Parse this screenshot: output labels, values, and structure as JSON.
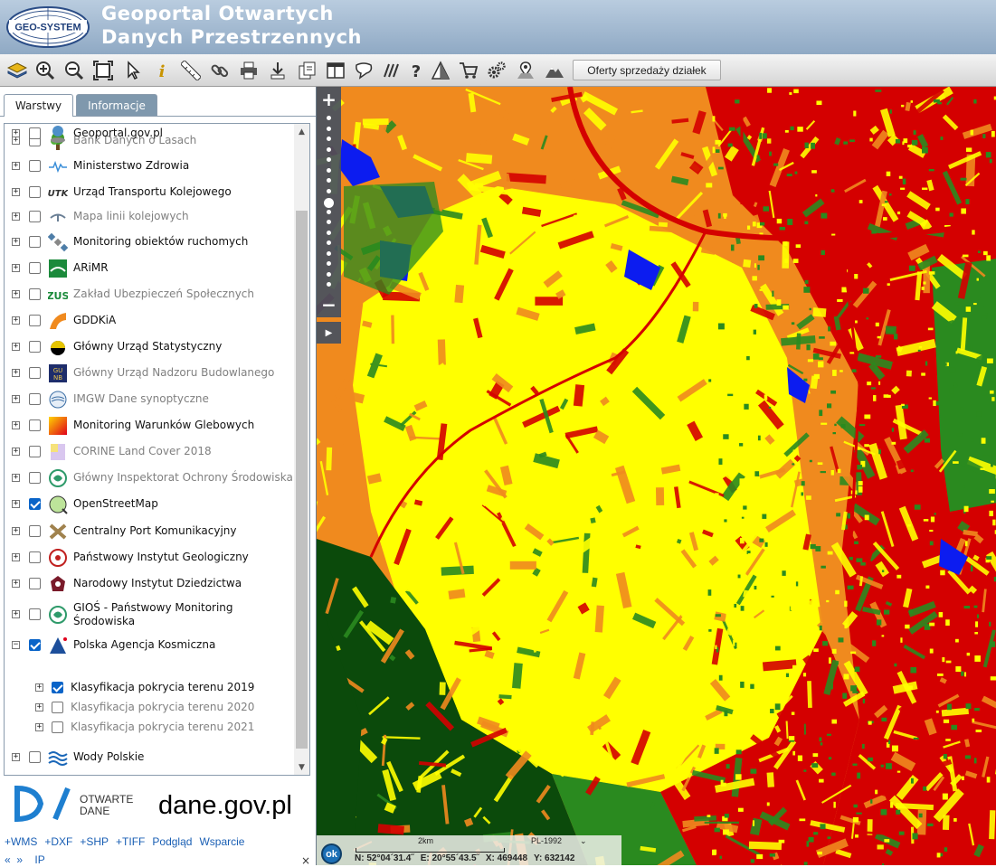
{
  "header": {
    "logo_text": "GEO-SYSTEM",
    "title_line1": "Geoportal Otwartych",
    "title_line2": "Danych Przestrzennych"
  },
  "toolbar": {
    "icons": [
      "layers-icon",
      "zoom-in-icon",
      "zoom-out-icon",
      "zoom-extent-icon",
      "pointer-icon",
      "info-icon",
      "ruler-icon",
      "link-icon",
      "print-icon",
      "download-icon",
      "import-icon",
      "layout-icon",
      "speech-icon",
      "hatch-icon",
      "help-icon",
      "triangle-icon",
      "cart-icon",
      "gears-icon",
      "location-pin-icon",
      "mountain-icon"
    ],
    "offers_label": "Oferty sprzedaży działek"
  },
  "tabs": {
    "layers": "Warstwy",
    "info": "Informacje"
  },
  "layers": [
    {
      "name": "Bank Danych o Lasach",
      "checked": false,
      "active": false,
      "icon": "tree-icon"
    },
    {
      "name": "Ministerstwo Zdrowia",
      "checked": false,
      "active": true,
      "icon": "heartbeat-icon"
    },
    {
      "name": "Urząd Transportu Kolejowego",
      "checked": false,
      "active": true,
      "icon": "utk-icon"
    },
    {
      "name": "Mapa linii kolejowych",
      "checked": false,
      "active": false,
      "icon": "rail-icon"
    },
    {
      "name": "Monitoring obiektów ruchomych",
      "checked": false,
      "active": true,
      "icon": "satellite-icon"
    },
    {
      "name": "ARiMR",
      "checked": false,
      "active": true,
      "icon": "arimr-icon"
    },
    {
      "name": "Zakład Ubezpieczeń Społecznych",
      "checked": false,
      "active": false,
      "icon": "zus-icon"
    },
    {
      "name": "GDDKiA",
      "checked": false,
      "active": true,
      "icon": "road-icon"
    },
    {
      "name": "Główny Urząd Statystyczny",
      "checked": false,
      "active": true,
      "icon": "gus-icon"
    },
    {
      "name": "Główny Urząd Nadzoru Budowlanego",
      "checked": false,
      "active": false,
      "icon": "gunb-icon"
    },
    {
      "name": "IMGW Dane synoptyczne",
      "checked": false,
      "active": false,
      "icon": "imgw-icon"
    },
    {
      "name": "Monitoring Warunków Glebowych",
      "checked": false,
      "active": true,
      "icon": "soil-icon"
    },
    {
      "name": "CORINE Land Cover 2018",
      "checked": false,
      "active": false,
      "icon": "corine-icon"
    },
    {
      "name": "Główny Inspektorat Ochrony Środowiska",
      "checked": false,
      "active": false,
      "icon": "gios-icon"
    },
    {
      "name": "OpenStreetMap",
      "checked": true,
      "active": true,
      "icon": "osm-icon"
    },
    {
      "name": "Centralny Port Komunikacyjny",
      "checked": false,
      "active": true,
      "icon": "cpk-icon"
    },
    {
      "name": "Państwowy Instytut Geologiczny",
      "checked": false,
      "active": true,
      "icon": "pig-icon"
    },
    {
      "name": "Narodowy Instytut Dziedzictwa",
      "checked": false,
      "active": true,
      "icon": "nid-icon"
    },
    {
      "name": "GIOŚ - Państwowy Monitoring Środowiska",
      "name_line1": "GIOŚ - Państwowy Monitoring",
      "name_line2": "Środowiska",
      "checked": false,
      "active": true,
      "icon": "gios-icon"
    },
    {
      "name": "Polska Agencja Kosmiczna",
      "checked": true,
      "active": true,
      "expanded": true,
      "icon": "polsa-icon",
      "children": [
        {
          "name": "Klasyfikacja pokrycia terenu 2019",
          "checked": true,
          "active": true
        },
        {
          "name": "Klasyfikacja pokrycia terenu 2020",
          "checked": false,
          "active": false
        },
        {
          "name": "Klasyfikacja pokrycia terenu 2021",
          "checked": false,
          "active": false
        }
      ]
    },
    {
      "name": "Wody Polskie",
      "checked": false,
      "active": true,
      "icon": "water-icon"
    },
    {
      "name": "Geoportal.gov.pl",
      "checked": false,
      "active": true,
      "icon": "geoportal-icon"
    }
  ],
  "banner": {
    "otwarte": "OTWARTE",
    "dane": "DANE",
    "domain": "dane.gov.pl"
  },
  "links": [
    "+WMS",
    "+DXF",
    "+SHP",
    "+TIFF",
    "Podgląd",
    "Wsparcie"
  ],
  "bottom_nav": {
    "prev": "«",
    "next": "»",
    "ip": "IP",
    "close": "×"
  },
  "map": {
    "colors": {
      "crop": "#ffff00",
      "bare": "#f08a1e",
      "built": "#d40000",
      "forest": "#0b4a0b",
      "grass": "#2a8a1f",
      "water": "#0c1cf0"
    },
    "scale_label": "2km",
    "crs": "PL-1992",
    "ok_label": "ok",
    "coords": {
      "n": "N: 52°04´31.4˝",
      "e": "E: 20°55´43.5˝",
      "x": "X: 469448",
      "y": "Y: 632142"
    }
  }
}
